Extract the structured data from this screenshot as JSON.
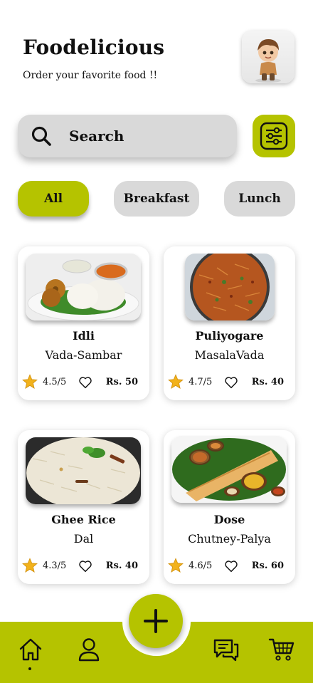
{
  "header": {
    "title": "Foodelicious",
    "subtitle": "Order your favorite food !!"
  },
  "search": {
    "placeholder": "Search"
  },
  "categories": [
    {
      "label": "All",
      "active": true
    },
    {
      "label": "Breakfast",
      "active": false
    },
    {
      "label": "Lunch",
      "active": false
    }
  ],
  "foods": [
    {
      "name": "Idli",
      "sub": "Vada-Sambar",
      "rating": "4.5/5",
      "price": "Rs. 50"
    },
    {
      "name": "Puliyogare",
      "sub": "MasalaVada",
      "rating": "4.7/5",
      "price": "Rs. 40"
    },
    {
      "name": "Ghee Rice",
      "sub": "Dal",
      "rating": "4.3/5",
      "price": "Rs. 40"
    },
    {
      "name": "Dose",
      "sub": "Chutney-Palya",
      "rating": "4.6/5",
      "price": "Rs. 60"
    }
  ],
  "colors": {
    "accent": "#b5c300",
    "chip": "#d9d9d9",
    "star": "#f2b21b"
  },
  "icons": {
    "search": "search-icon",
    "filter": "filter-sliders-icon",
    "rating": "star-icon",
    "favorite": "heart-icon",
    "add": "plus-icon",
    "home": "home-icon",
    "profile": "user-icon",
    "chat": "chat-icon",
    "cart": "cart-icon"
  }
}
